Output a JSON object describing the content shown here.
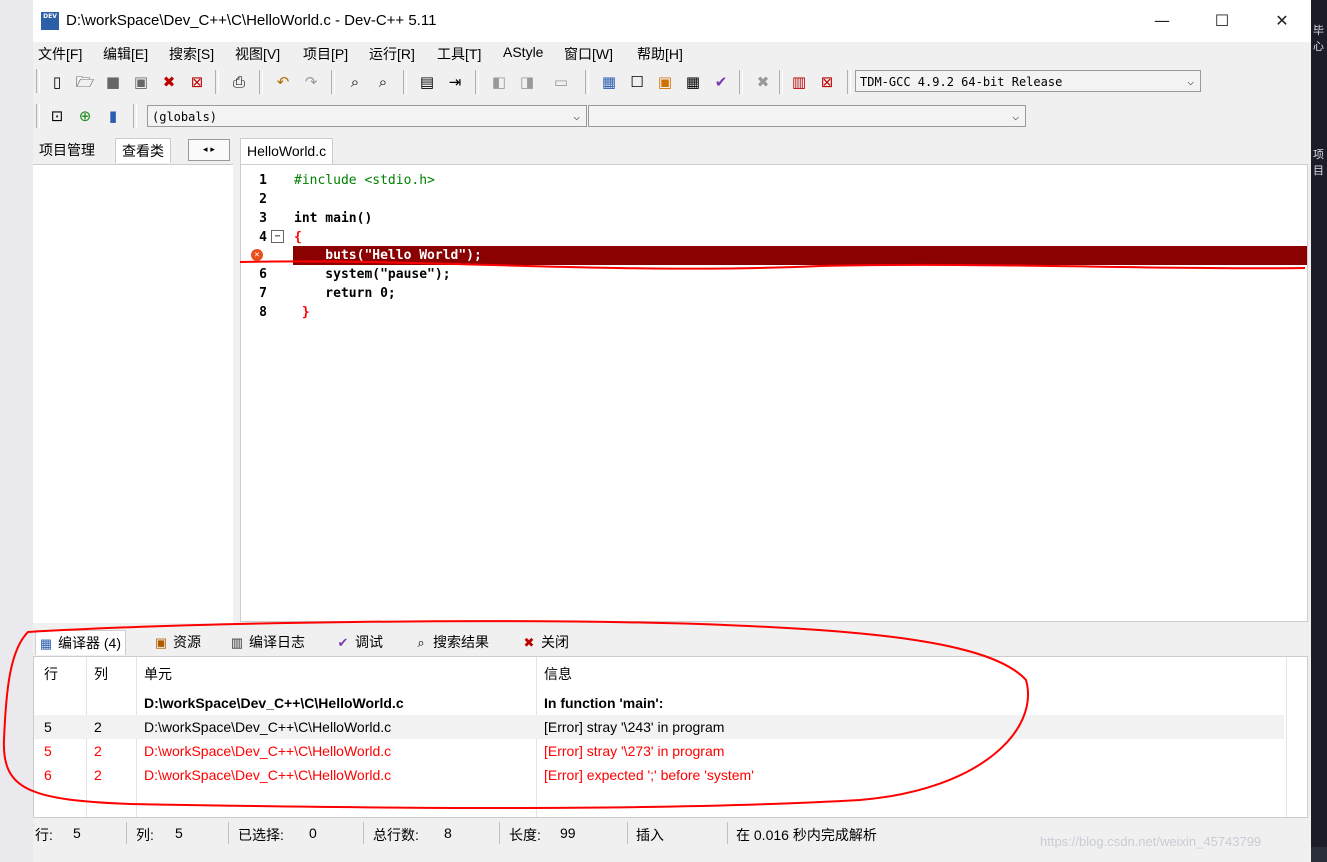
{
  "window": {
    "title": "D:\\workSpace\\Dev_C++\\C\\HelloWorld.c - Dev-C++ 5.11",
    "app_icon_text": "DEV",
    "controls": {
      "minimize": "—",
      "maximize": "☐",
      "close": "✕"
    }
  },
  "desktop": {
    "right_fragment_1": "毕心",
    "right_fragment_2": "项目",
    "watermark": "https://blog.csdn.net/weixin_45743799"
  },
  "menu": [
    "文件[F]",
    "编辑[E]",
    "搜索[S]",
    "视图[V]",
    "项目[P]",
    "运行[R]",
    "工具[T]",
    "AStyle",
    "窗口[W]",
    "帮助[H]"
  ],
  "toolbar": {
    "compiler_select": "TDM-GCC 4.9.2 64-bit Release",
    "globals_select": "(globals)",
    "member_select": ""
  },
  "left_panel": {
    "tabs": [
      "项目管理",
      "查看类"
    ],
    "arrows": "◂ ▸"
  },
  "editor": {
    "file_tab": "HelloWorld.c",
    "line_numbers": [
      "1",
      "2",
      "3",
      "4",
      "5",
      "6",
      "7",
      "8"
    ],
    "lines": [
      "#include <stdio.h>",
      "",
      "int main()",
      "{",
      "    buts(\"Hello World\");",
      "    system(\"pause\");",
      "    return 0;",
      " }"
    ],
    "fold_symbol": "−",
    "error_line": 5
  },
  "bottom_panel": {
    "tabs": [
      {
        "label": "编译器 (4)",
        "icon": "grid-icon"
      },
      {
        "label": "资源",
        "icon": "resources-icon"
      },
      {
        "label": "编译日志",
        "icon": "chart-icon"
      },
      {
        "label": "调试",
        "icon": "check-icon"
      },
      {
        "label": "搜索结果",
        "icon": "search-icon"
      },
      {
        "label": "关闭",
        "icon": "close-icon"
      }
    ],
    "columns": [
      "行",
      "列",
      "单元",
      "信息"
    ],
    "rows": [
      {
        "line": "",
        "col": "",
        "unit": "D:\\workSpace\\Dev_C++\\C\\HelloWorld.c",
        "message": "In function 'main':"
      },
      {
        "line": "5",
        "col": "2",
        "unit": "D:\\workSpace\\Dev_C++\\C\\HelloWorld.c",
        "message": "[Error] stray '\\243' in program"
      },
      {
        "line": "5",
        "col": "2",
        "unit": "D:\\workSpace\\Dev_C++\\C\\HelloWorld.c",
        "message": "[Error] stray '\\273' in program"
      },
      {
        "line": "6",
        "col": "2",
        "unit": "D:\\workSpace\\Dev_C++\\C\\HelloWorld.c",
        "message": "[Error] expected ';' before 'system'"
      }
    ]
  },
  "status": {
    "row_label": "行:",
    "row_value": "5",
    "col_label": "列:",
    "col_value": "5",
    "sel_label": "已选择:",
    "sel_value": "0",
    "total_label": "总行数:",
    "total_value": "8",
    "len_label": "长度:",
    "len_value": "99",
    "mode": "插入",
    "parse_msg": "在 0.016 秒内完成解析"
  },
  "colors": {
    "error_line_bg": "#8b0000",
    "error_text": "#ff0000",
    "annotation": "#ff0000"
  }
}
